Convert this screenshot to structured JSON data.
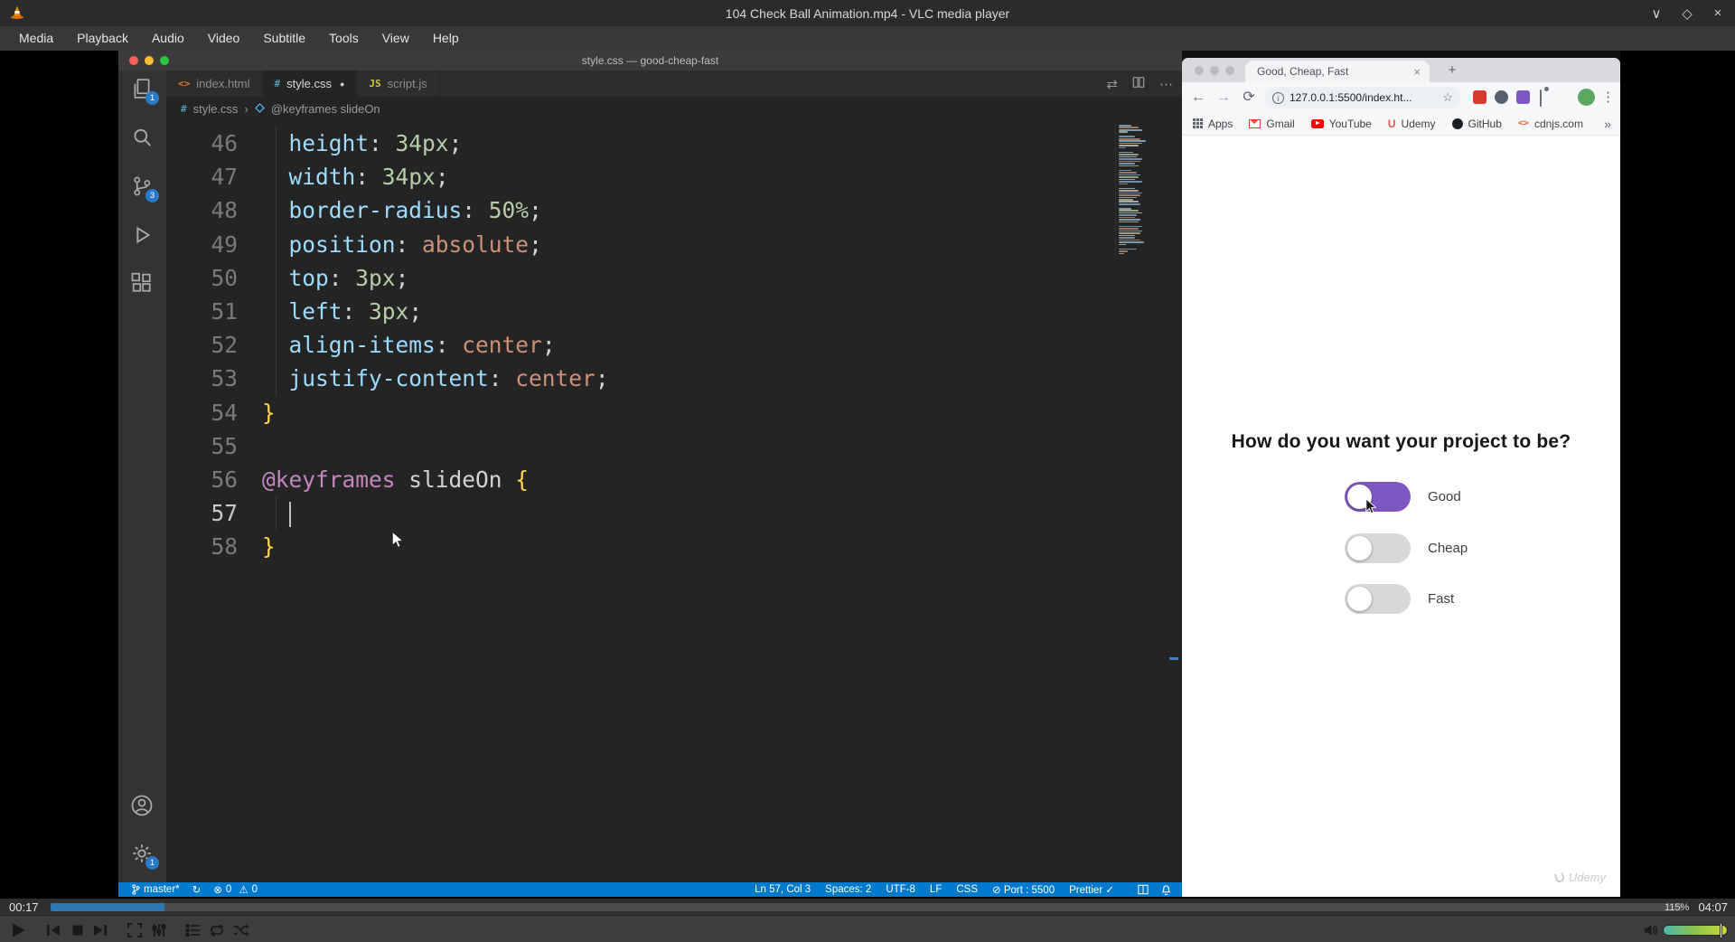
{
  "vlc": {
    "window_title": "104 Check Ball Animation.mp4 - VLC media player",
    "menu": [
      "Media",
      "Playback",
      "Audio",
      "Video",
      "Subtitle",
      "Tools",
      "View",
      "Help"
    ],
    "window_controls": {
      "minimize": "∨",
      "maximize": "◇",
      "close": "×"
    },
    "seek": {
      "elapsed": "00:17",
      "total": "04:07",
      "progress_percent": 7
    },
    "volume": {
      "label": "115%"
    }
  },
  "vscode": {
    "window_title": "style.css — good-cheap-fast",
    "tabs": [
      {
        "label": "index.html",
        "icon": "<>",
        "icon_color": "#e37933",
        "active": false,
        "dirty": false
      },
      {
        "label": "style.css",
        "icon": "#",
        "icon_color": "#519aba",
        "active": true,
        "dirty": true
      },
      {
        "label": "script.js",
        "icon": "JS",
        "icon_color": "#cbcb41",
        "active": false,
        "dirty": false
      }
    ],
    "tab_actions": {
      "compare": "⇄",
      "more": "⋯"
    },
    "breadcrumb": {
      "file_icon": "#",
      "file": "style.css",
      "separator": "›",
      "symbol": "@keyframes slideOn"
    },
    "activity_badges": {
      "explorer": "1",
      "scm": "3",
      "settings": "1"
    },
    "editor": {
      "lines": [
        {
          "num": "46",
          "tokens": [
            [
              "w",
              "  "
            ],
            [
              "p",
              "height"
            ],
            [
              "c",
              ": "
            ],
            [
              "n",
              "34px"
            ],
            [
              "c",
              ";"
            ]
          ]
        },
        {
          "num": "47",
          "tokens": [
            [
              "w",
              "  "
            ],
            [
              "p",
              "width"
            ],
            [
              "c",
              ": "
            ],
            [
              "n",
              "34px"
            ],
            [
              "c",
              ";"
            ]
          ]
        },
        {
          "num": "48",
          "tokens": [
            [
              "w",
              "  "
            ],
            [
              "p",
              "border-radius"
            ],
            [
              "c",
              ": "
            ],
            [
              "n",
              "50%"
            ],
            [
              "c",
              ";"
            ]
          ]
        },
        {
          "num": "49",
          "tokens": [
            [
              "w",
              "  "
            ],
            [
              "p",
              "position"
            ],
            [
              "c",
              ": "
            ],
            [
              "v",
              "absolute"
            ],
            [
              "c",
              ";"
            ]
          ]
        },
        {
          "num": "50",
          "tokens": [
            [
              "w",
              "  "
            ],
            [
              "p",
              "top"
            ],
            [
              "c",
              ": "
            ],
            [
              "n",
              "3px"
            ],
            [
              "c",
              ";"
            ]
          ]
        },
        {
          "num": "51",
          "tokens": [
            [
              "w",
              "  "
            ],
            [
              "p",
              "left"
            ],
            [
              "c",
              ": "
            ],
            [
              "n",
              "3px"
            ],
            [
              "c",
              ";"
            ]
          ]
        },
        {
          "num": "52",
          "tokens": [
            [
              "w",
              "  "
            ],
            [
              "p",
              "align-items"
            ],
            [
              "c",
              ": "
            ],
            [
              "v",
              "center"
            ],
            [
              "c",
              ";"
            ]
          ]
        },
        {
          "num": "53",
          "tokens": [
            [
              "w",
              "  "
            ],
            [
              "p",
              "justify-content"
            ],
            [
              "c",
              ": "
            ],
            [
              "v",
              "center"
            ],
            [
              "c",
              ";"
            ]
          ]
        },
        {
          "num": "54",
          "tokens": [
            [
              "b",
              "}"
            ]
          ]
        },
        {
          "num": "55",
          "tokens": []
        },
        {
          "num": "56",
          "tokens": [
            [
              "a",
              "@keyframes"
            ],
            [
              "d",
              " slideOn"
            ],
            [
              "b",
              " {"
            ]
          ]
        },
        {
          "num": "57",
          "tokens": [
            [
              "w",
              "  "
            ]
          ],
          "caret": true
        },
        {
          "num": "58",
          "tokens": [
            [
              "b",
              "}"
            ]
          ]
        }
      ]
    },
    "status": {
      "branch": "master*",
      "errors": "0",
      "warnings": "0"
    },
    "icons": {
      "sync": "↻",
      "error": "⊗",
      "warning": "⚠"
    },
    "status_right": [
      "Ln 57, Col 3",
      "Spaces: 2",
      "UTF-8",
      "LF",
      "CSS",
      "⊘ Port : 5500",
      "Prettier ✓"
    ]
  },
  "chrome": {
    "tab_title": "Good, Cheap, Fast",
    "url": "127.0.0.1:5500/index.ht...",
    "controls": {
      "close_tab": "×",
      "new_tab": "+",
      "back": "←",
      "forward": "→",
      "reload": "⟳",
      "info": "i",
      "star": "☆",
      "menu": "⋮",
      "overflow": "»"
    },
    "bookmarks": [
      {
        "label": "Apps",
        "icon": "apps-grid"
      },
      {
        "label": "Gmail",
        "icon": "gmail"
      },
      {
        "label": "YouTube",
        "icon": "youtube"
      },
      {
        "label": "Udemy",
        "icon": "udemy"
      },
      {
        "label": "GitHub",
        "icon": "github"
      },
      {
        "label": "cdnjs.com",
        "icon": "cdnjs"
      }
    ],
    "page": {
      "heading": "How do you want your project to be?",
      "toggles": [
        {
          "label": "Good",
          "checked": true
        },
        {
          "label": "Cheap",
          "checked": false
        },
        {
          "label": "Fast",
          "checked": false
        }
      ],
      "watermark": "Udemy"
    }
  },
  "colors": {
    "toggle_on": "#7e57c2",
    "toggle_off": "#d8d8d8",
    "seek_fill": "#2f77ad",
    "statusbar": "#007acc"
  }
}
